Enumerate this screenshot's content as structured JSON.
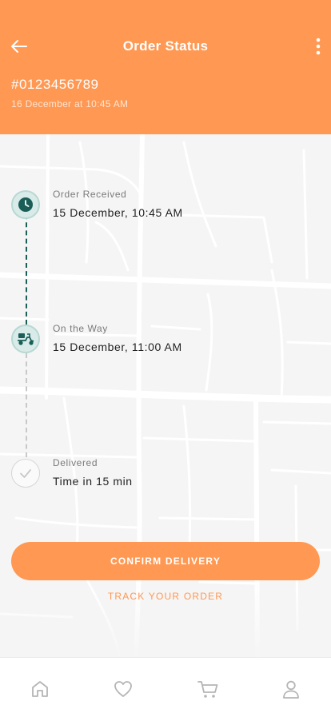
{
  "header": {
    "title": "Order Status",
    "order_number": "#0123456789",
    "order_date": "16 December at 10:45 AM",
    "background_color": "#ff9852"
  },
  "icons": {
    "back": "arrow-left-icon",
    "more": "more-vertical-icon",
    "received": "clock-icon",
    "on_the_way": "scooter-icon",
    "delivered": "checkmark-icon"
  },
  "timeline": [
    {
      "label": "Order Received",
      "value": "15 December, 10:45 AM",
      "status": "done"
    },
    {
      "label": "On the Way",
      "value": "15 December, 11:00 AM",
      "status": "done"
    },
    {
      "label": "Delivered",
      "value": "Time in 15 min",
      "status": "pending"
    }
  ],
  "actions": {
    "confirm_label": "CONFIRM DELIVERY",
    "track_label": "TRACK YOUR ORDER"
  },
  "bottom_nav": [
    {
      "icon": "home-icon"
    },
    {
      "icon": "heart-icon"
    },
    {
      "icon": "cart-icon"
    },
    {
      "icon": "user-icon"
    }
  ],
  "colors": {
    "accent": "#ff9852",
    "timeline_active": "#1a5e57",
    "timeline_pending": "#c8c8c8"
  }
}
